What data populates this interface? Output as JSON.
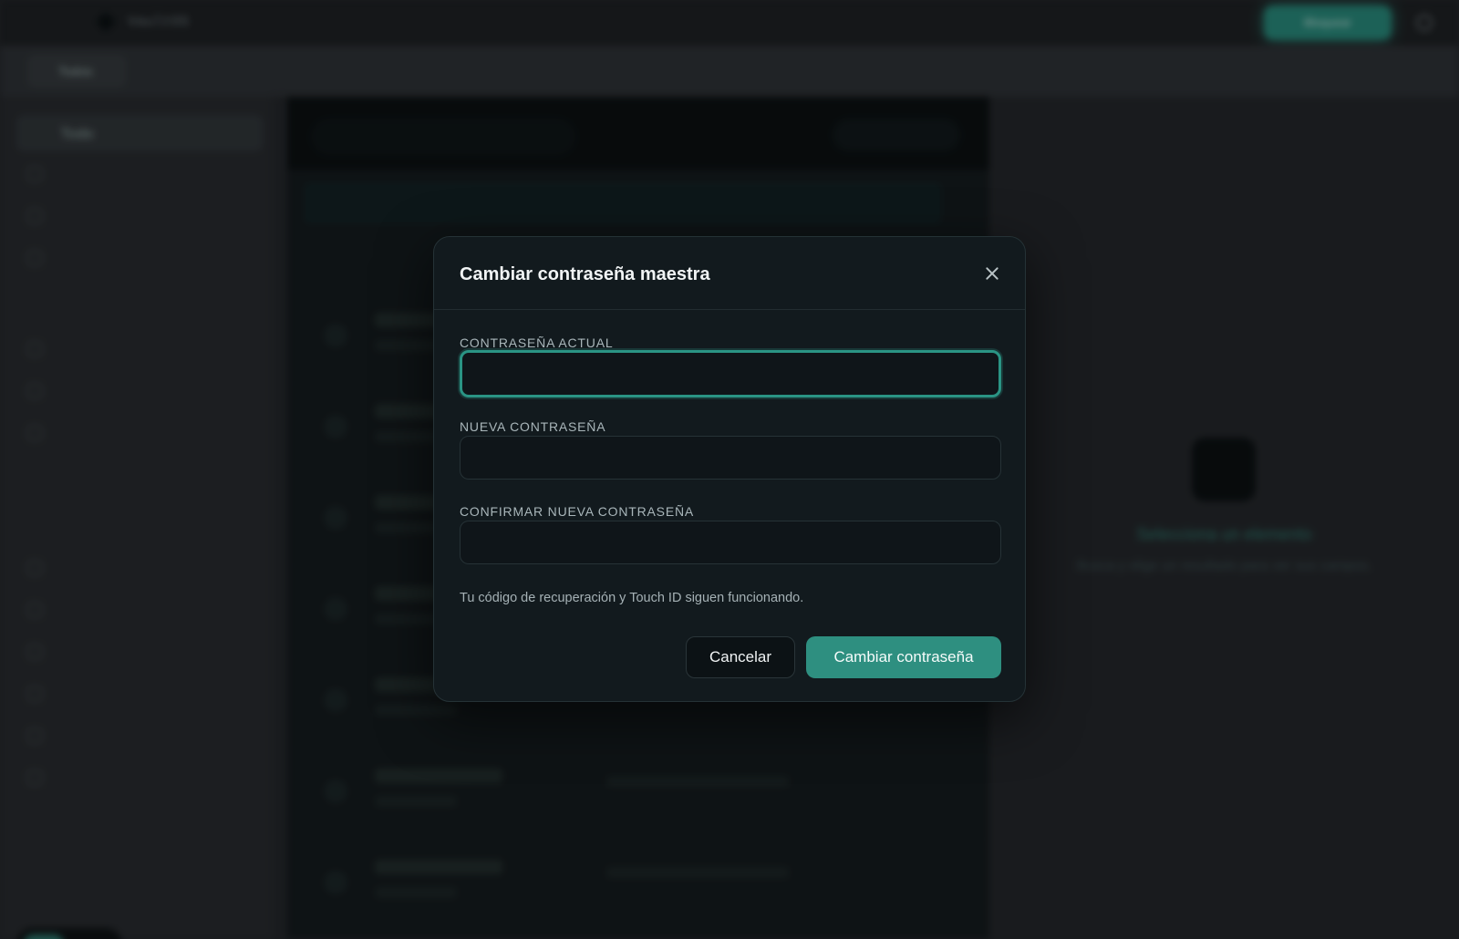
{
  "app": {
    "brand": "VaultOS",
    "top_button": "Bloquear"
  },
  "tabs": [
    {
      "label": "Todos"
    }
  ],
  "sidebar": {
    "active_item": "Todo"
  },
  "detail_empty": {
    "title": "Selecciona un elemento",
    "subtitle": "Busca y elige un resultado para ver sus campos."
  },
  "modal": {
    "title": "Cambiar contraseña maestra",
    "fields": {
      "current": {
        "label": "CONTRASEÑA ACTUAL",
        "value": ""
      },
      "new": {
        "label": "NUEVA CONTRASEÑA",
        "value": ""
      },
      "confirm": {
        "label": "CONFIRMAR NUEVA CONTRASEÑA",
        "value": ""
      }
    },
    "hint": "Tu código de recuperación y Touch ID siguen funcionando.",
    "cancel_label": "Cancelar",
    "submit_label": "Cambiar contraseña"
  },
  "colors": {
    "accent": "#2e8f80",
    "background": "#26292d",
    "modal": "#121a1e"
  }
}
